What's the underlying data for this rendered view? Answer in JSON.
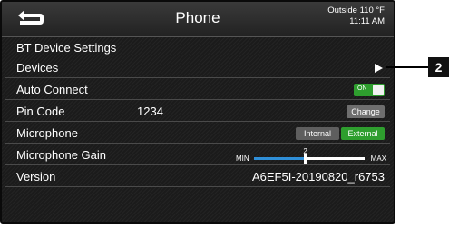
{
  "header": {
    "title": "Phone",
    "outside_temp": "Outside 110 °F",
    "time": "11:11 AM",
    "back_icon": "back-arrow-icon"
  },
  "section_title": "BT Device Settings",
  "rows": {
    "devices": {
      "label": "Devices",
      "icon": "play-arrow-icon"
    },
    "auto_connect": {
      "label": "Auto Connect",
      "toggle_label": "ON",
      "enabled": true
    },
    "pin_code": {
      "label": "Pin Code",
      "value": "1234",
      "button": "Change"
    },
    "microphone": {
      "label": "Microphone",
      "options": [
        "Internal",
        "External"
      ],
      "selected": "External"
    },
    "microphone_gain": {
      "label": "Microphone Gain",
      "min_label": "MIN",
      "max_label": "MAX",
      "value": "2",
      "level_fraction": 0.47
    },
    "version": {
      "label": "Version",
      "value": "A6EF5I-20190820_r6753"
    }
  },
  "callout": {
    "label": "2"
  },
  "colors": {
    "accent_green": "#2e9e2e",
    "slider_blue": "#2f8fd8",
    "background": "#1b1b1b"
  }
}
